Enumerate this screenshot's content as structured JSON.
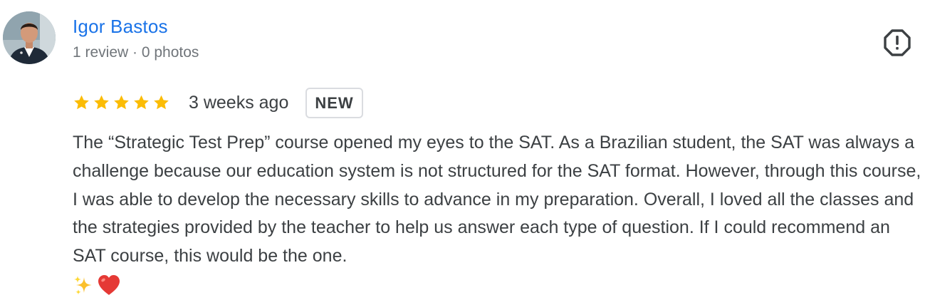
{
  "reviewer": {
    "name": "Igor Bastos",
    "meta": "1 review · 0 photos",
    "avatar_icon": "profile-photo"
  },
  "review": {
    "rating": 5,
    "rating_max": 5,
    "star_color": "#fbbc04",
    "time_ago": "3 weeks ago",
    "badge": "NEW",
    "text": "The “Strategic Test Prep” course opened my eyes to the SAT. As a Brazilian student, the SAT was always a challenge because our education system is not structured for the SAT format. However, through this course, I was able to develop the necessary skills to advance in my preparation. Overall, I loved all the classes and the strategies provided by the teacher to help us answer each type of question. If I could recommend an SAT course, this would be the one.",
    "emojis": [
      "sparkles-icon",
      "red-heart-icon"
    ]
  },
  "actions": {
    "report_icon": "report-flag-icon"
  },
  "colors": {
    "name_link": "#1a73e8",
    "meta_text": "#70757a",
    "body_text": "#3c4043",
    "badge_border": "#dadce0"
  }
}
